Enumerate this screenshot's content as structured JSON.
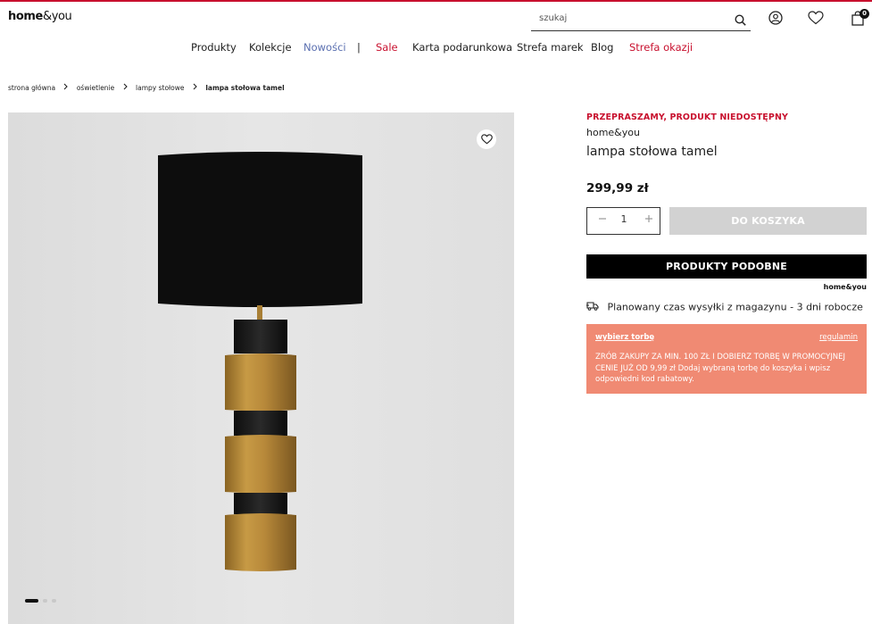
{
  "brand_colors": {
    "accent_red": "#c8102e",
    "nav_blue": "#5a6fb0",
    "promo_bg": "#f08a73"
  },
  "header": {
    "logo": {
      "bold": "home",
      "rest": "&you"
    },
    "search_placeholder": "szukaj",
    "cart_count": "0",
    "icons": [
      "search-icon",
      "user-icon",
      "heart-icon",
      "cart-bag-icon"
    ]
  },
  "nav": {
    "items": [
      {
        "label": "Produkty"
      },
      {
        "label": "Kolekcje"
      },
      {
        "label": "Nowości"
      },
      {
        "label": "|"
      },
      {
        "label": "Sale"
      },
      {
        "label": "Karta podarunkowa"
      },
      {
        "label": "Strefa marek"
      },
      {
        "label": "Blog"
      },
      {
        "label": "Strefa okazji"
      }
    ]
  },
  "breadcrumb": {
    "items": [
      {
        "label": "strona główna"
      },
      {
        "label": "oświetlenie"
      },
      {
        "label": "lampy stołowe"
      },
      {
        "label": "lampa stołowa tamel"
      }
    ]
  },
  "gallery": {
    "slides": 3,
    "active_slide": 1
  },
  "product": {
    "unavailable": "PRZEPRASZAMY, PRODUKT NIEDOSTĘPNY",
    "brand": "home&you",
    "title": "lampa stołowa tamel",
    "price": "299,99 zł",
    "quantity": "1",
    "add_to_cart": "DO KOSZYKA",
    "similar_products": "PRODUKTY PODOBNE",
    "similar_brand": "home&you",
    "shipping": "Planowany czas wysyłki z magazynu - 3 dni robocze"
  },
  "promo": {
    "choose_bag": "wybierz torbę",
    "terms": "regulamin",
    "description": "ZRÓB ZAKUPY ZA MIN. 100 ZŁ I DOBIERZ TORBĘ W PROMOCYJNEJ CENIE JUŻ OD 9,99 zł Dodaj wybraną torbę do koszyka i wpisz odpowiedni kod rabatowy."
  }
}
